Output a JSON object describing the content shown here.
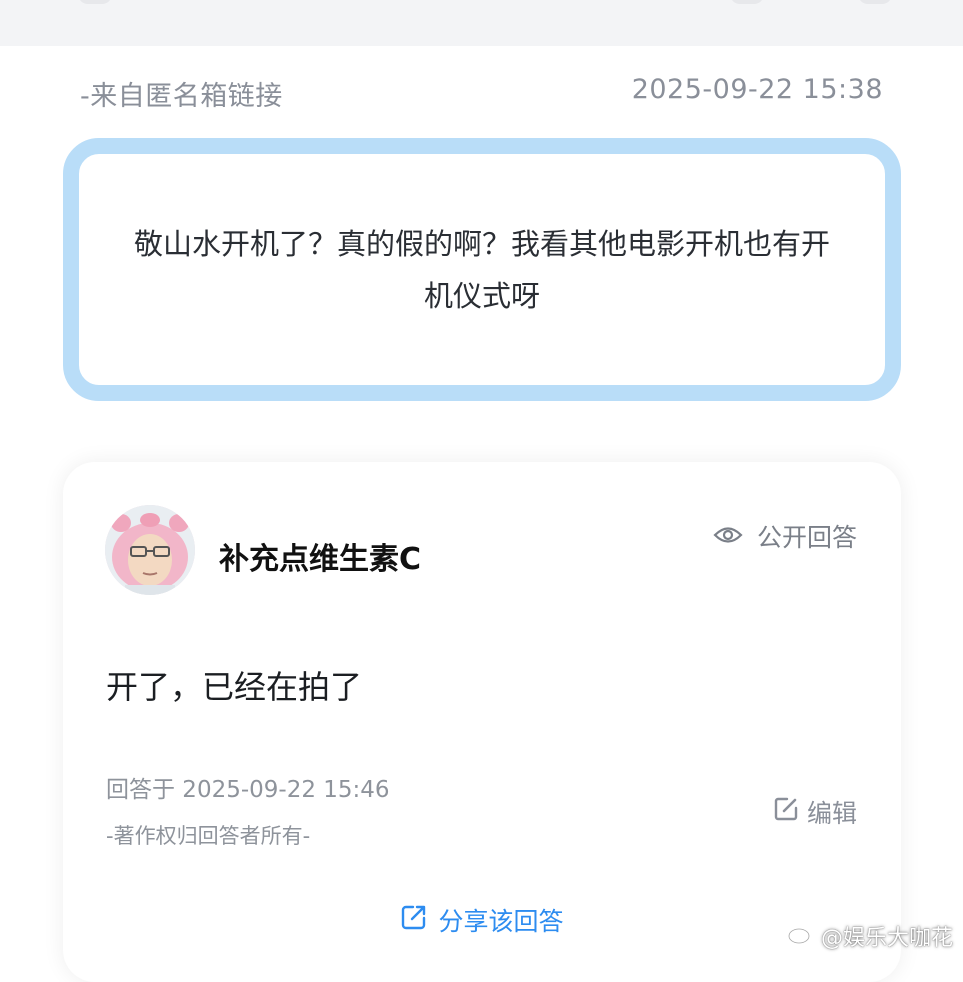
{
  "meta": {
    "source": "-来自匿名箱链接",
    "timestamp": "2025-09-22 15:38"
  },
  "question": {
    "text": "敬山水开机了？真的假的啊？我看其他电影开机也有开机仪式呀"
  },
  "answer": {
    "username": "补充点维生素C",
    "visibility_label": "公开回答",
    "text": "开了，已经在拍了",
    "answered_at": "回答于 2025-09-22 15:46",
    "copyright": "-著作权归回答者所有-",
    "edit_label": "编辑",
    "share_label": "分享该回答"
  },
  "watermark": {
    "text": "@娱乐大咖花"
  },
  "icons": {
    "visibility": "eye-icon",
    "edit": "edit-icon",
    "share": "share-icon",
    "watermark_logo": "weibo-logo-icon"
  },
  "colors": {
    "question_border": "#b9ddf8",
    "accent": "#2d8cf0",
    "muted_text": "#8a8f99",
    "background_top": "#f3f4f6"
  }
}
